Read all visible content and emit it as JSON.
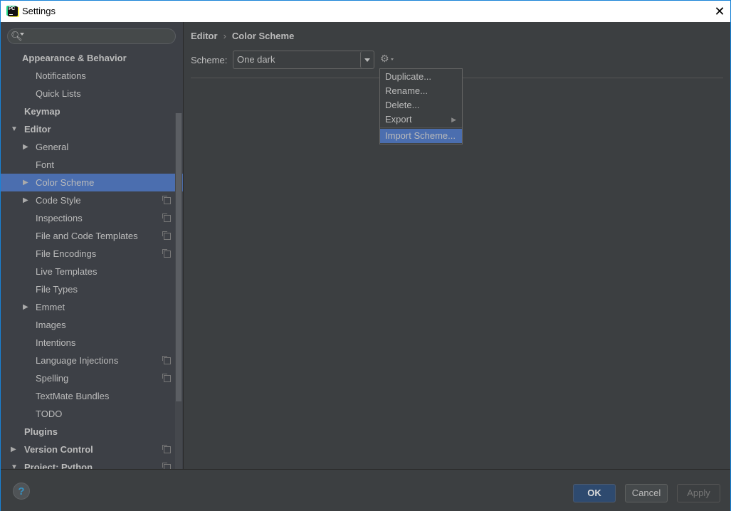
{
  "window": {
    "title": "Settings",
    "close_glyph": "✕"
  },
  "search": {
    "placeholder": "",
    "icon": "search-icon"
  },
  "sidebar": {
    "items": [
      {
        "label": "Appearance & Behavior",
        "level": 0,
        "arrow": "",
        "copy": false
      },
      {
        "label": "Notifications",
        "level": 1,
        "arrow": "",
        "copy": false
      },
      {
        "label": "Quick Lists",
        "level": 1,
        "arrow": "",
        "copy": false
      },
      {
        "label": "Keymap",
        "level": 0,
        "arrow": "",
        "copy": false
      },
      {
        "label": "Editor",
        "level": 0,
        "arrow": "▼",
        "copy": false
      },
      {
        "label": "General",
        "level": 1,
        "arrow": "▶",
        "copy": false
      },
      {
        "label": "Font",
        "level": 1,
        "arrow": "",
        "copy": false
      },
      {
        "label": "Color Scheme",
        "level": 1,
        "arrow": "▶",
        "copy": false,
        "selected": true
      },
      {
        "label": "Code Style",
        "level": 1,
        "arrow": "▶",
        "copy": true
      },
      {
        "label": "Inspections",
        "level": 1,
        "arrow": "",
        "copy": true
      },
      {
        "label": "File and Code Templates",
        "level": 1,
        "arrow": "",
        "copy": true
      },
      {
        "label": "File Encodings",
        "level": 1,
        "arrow": "",
        "copy": true
      },
      {
        "label": "Live Templates",
        "level": 1,
        "arrow": "",
        "copy": false
      },
      {
        "label": "File Types",
        "level": 1,
        "arrow": "",
        "copy": false
      },
      {
        "label": "Emmet",
        "level": 1,
        "arrow": "▶",
        "copy": false
      },
      {
        "label": "Images",
        "level": 1,
        "arrow": "",
        "copy": false
      },
      {
        "label": "Intentions",
        "level": 1,
        "arrow": "",
        "copy": false
      },
      {
        "label": "Language Injections",
        "level": 1,
        "arrow": "",
        "copy": true
      },
      {
        "label": "Spelling",
        "level": 1,
        "arrow": "",
        "copy": true
      },
      {
        "label": "TextMate Bundles",
        "level": 1,
        "arrow": "",
        "copy": false
      },
      {
        "label": "TODO",
        "level": 1,
        "arrow": "",
        "copy": false
      },
      {
        "label": "Plugins",
        "level": 0,
        "arrow": "",
        "copy": false
      },
      {
        "label": "Version Control",
        "level": 0,
        "arrow": "▶",
        "copy": true
      },
      {
        "label": "Project: Python",
        "level": 0,
        "arrow": "▼",
        "copy": true
      }
    ]
  },
  "breadcrumb": {
    "parent": "Editor",
    "separator": "›",
    "current": "Color Scheme"
  },
  "scheme": {
    "label": "Scheme:",
    "value": "One dark"
  },
  "gear_menu": {
    "items": [
      {
        "label": "Duplicate...",
        "submenu": false
      },
      {
        "label": "Rename...",
        "submenu": false
      },
      {
        "label": "Delete...",
        "submenu": false
      },
      {
        "label": "Export",
        "submenu": true
      },
      {
        "label": "Import Scheme...",
        "submenu": false,
        "highlighted": true
      }
    ]
  },
  "footer": {
    "help": "?",
    "ok": "OK",
    "cancel": "Cancel",
    "apply": "Apply"
  },
  "colors": {
    "accent": "#4b6eaf",
    "window_border": "#1883d7",
    "background": "#3c3f41",
    "sidebar": "#3d4046"
  }
}
